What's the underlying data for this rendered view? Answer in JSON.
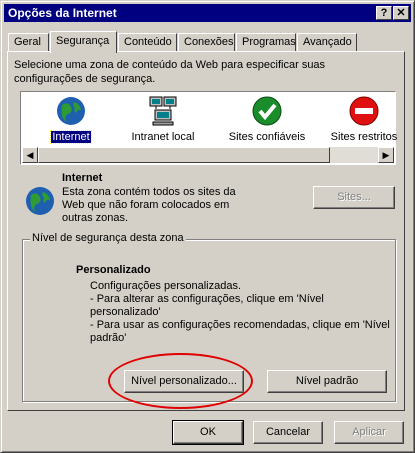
{
  "window": {
    "title": "Opções da Internet",
    "help_glyph": "?",
    "close_glyph": "✕"
  },
  "tabs": [
    "Geral",
    "Segurança",
    "Conteúdo",
    "Conexões",
    "Programas",
    "Avançado"
  ],
  "intro": "Selecione uma zona de conteúdo da Web para especificar suas configurações de segurança.",
  "zones": [
    {
      "label": "Internet",
      "icon": "globe-icon"
    },
    {
      "label": "Intranet local",
      "icon": "network-computer-icon"
    },
    {
      "label": "Sites confiáveis",
      "icon": "trusted-check-icon"
    },
    {
      "label": "Sites restritos",
      "icon": "restricted-icon"
    }
  ],
  "zone_info": {
    "title": "Internet",
    "description": "Esta zona contém todos os sites da Web que não foram colocados em outras zonas.",
    "sites_button": "Sites..."
  },
  "security": {
    "group_label": "Nível de segurança desta zona",
    "level_title": "Personalizado",
    "line1": "Configurações personalizadas.",
    "line2": "- Para alterar as configurações, clique em 'Nível personalizado'",
    "line3": "- Para usar as configurações recomendadas, clique em 'Nível padrão'",
    "custom_button": "Nível personalizado...",
    "default_button": "Nível padrão"
  },
  "footer": {
    "ok": "OK",
    "cancel": "Cancelar",
    "apply": "Aplicar"
  },
  "colors": {
    "titlebar": "#000080",
    "face": "#d4d0c8",
    "highlight_circle": "#e00000"
  }
}
